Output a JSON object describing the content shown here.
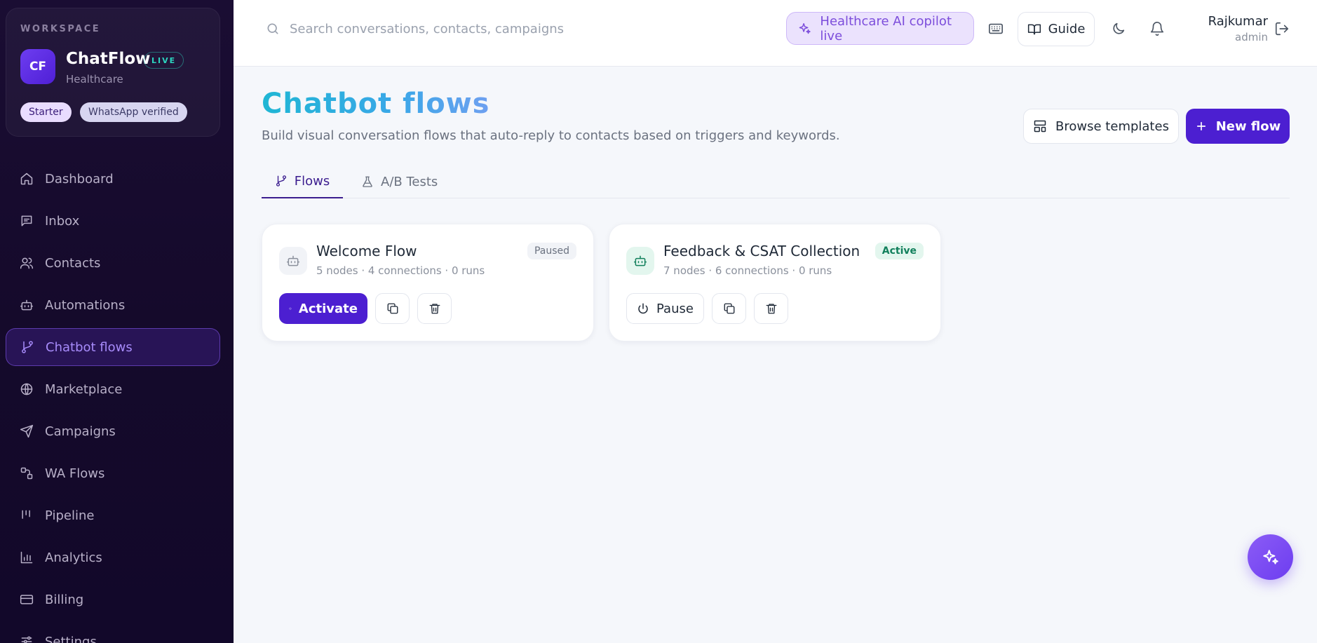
{
  "workspace": {
    "label": "WORKSPACE",
    "initials": "CF",
    "name": "ChatFlow",
    "live_badge": "LIVE",
    "subtitle": "Healthcare",
    "plan_badge": "Starter",
    "verified_badge": "WhatsApp verified"
  },
  "sidebar": {
    "items": [
      {
        "label": "Dashboard",
        "icon": "home-icon"
      },
      {
        "label": "Inbox",
        "icon": "message-icon"
      },
      {
        "label": "Contacts",
        "icon": "users-icon"
      },
      {
        "label": "Automations",
        "icon": "robot-icon"
      },
      {
        "label": "Chatbot flows",
        "icon": "git-branch-icon",
        "active": true
      },
      {
        "label": "Marketplace",
        "icon": "globe-icon"
      },
      {
        "label": "Campaigns",
        "icon": "send-icon"
      },
      {
        "label": "WA Flows",
        "icon": "workflow-icon"
      },
      {
        "label": "Pipeline",
        "icon": "pipeline-icon"
      },
      {
        "label": "Analytics",
        "icon": "bar-chart-icon"
      },
      {
        "label": "Billing",
        "icon": "credit-card-icon"
      },
      {
        "label": "Settings",
        "icon": "settings-icon"
      }
    ]
  },
  "topbar": {
    "search_placeholder": "Search conversations, contacts, campaigns",
    "copilot_label": "Healthcare AI copilot live",
    "guide_label": "Guide",
    "user_name": "Rajkumar",
    "user_role": "admin"
  },
  "page": {
    "title": "Chatbot flows",
    "subtitle": "Build visual conversation flows that auto-reply to contacts based on triggers and keywords.",
    "browse_templates_label": "Browse templates",
    "new_flow_label": "New flow"
  },
  "tabs": [
    {
      "label": "Flows",
      "active": true
    },
    {
      "label": "A/B Tests",
      "active": false
    }
  ],
  "flows": [
    {
      "title": "Welcome Flow",
      "meta": "5 nodes · 4 connections · 0 runs",
      "status": "Paused",
      "action_label": "Activate"
    },
    {
      "title": "Feedback & CSAT Collection",
      "meta": "7 nodes · 6 connections · 0 runs",
      "status": "Active",
      "action_label": "Pause"
    }
  ],
  "colors": {
    "accent": "#4c1fd1",
    "sidebar_bg": "#1a0d33",
    "active_green": "#12805c",
    "title_gradient_start": "#1fb6d4"
  }
}
